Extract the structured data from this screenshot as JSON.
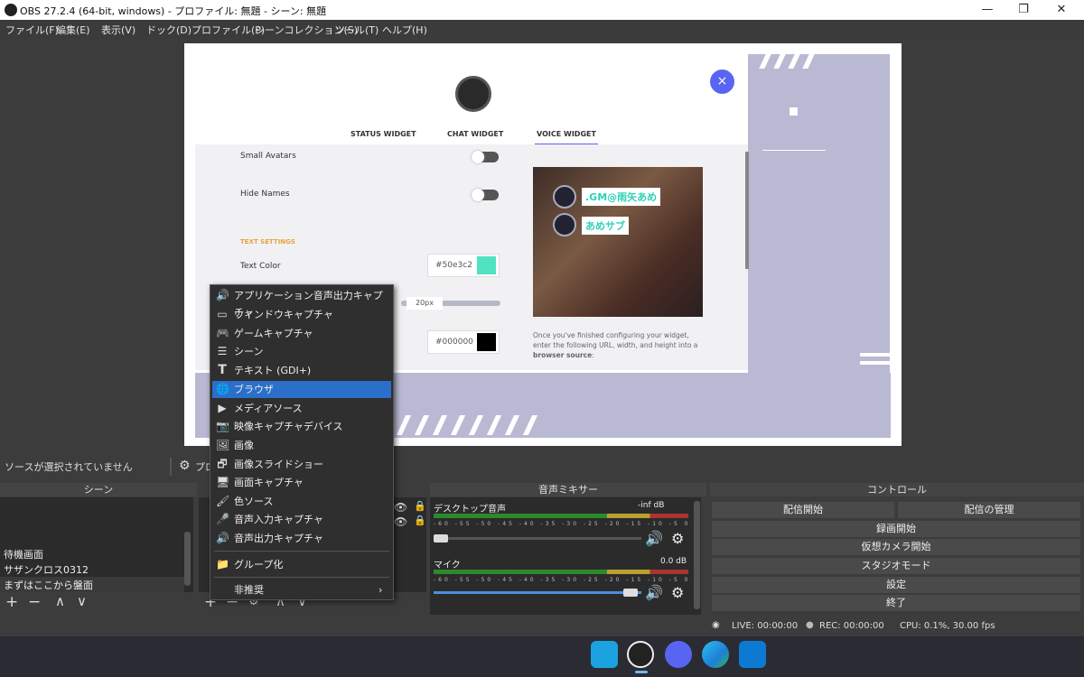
{
  "window": {
    "title": "OBS 27.2.4 (64-bit, windows) - プロファイル: 無題 - シーン: 無題",
    "minimize": "—",
    "maximize": "❐",
    "close": "✕"
  },
  "menubar": [
    "ファイル(F)",
    "編集(E)",
    "表示(V)",
    "ドック(D)",
    "プロファイル(P)",
    "シーンコレクション(S)",
    "ツール(T)",
    "ヘルプ(H)"
  ],
  "preview": {
    "tabs": [
      "STATUS WIDGET",
      "CHAT WIDGET",
      "VOICE WIDGET"
    ],
    "settings": {
      "small_avatars": "Small Avatars",
      "hide_names": "Hide Names",
      "text_settings": "TEXT SETTINGS",
      "text_color": "Text Color",
      "text_color_value": "#50e3c2",
      "size_value": "20px",
      "bg_color_value": "#000000"
    },
    "voice_names": [
      ".GM@雨矢あめ",
      "あめサブ"
    ],
    "help_text": "Once you've finished configuring your widget, enter the following URL, width, and height into a",
    "help_bold": "browser source",
    "help_colon": ":",
    "close_symbol": "×",
    "colors": {
      "accent": "#5865f2",
      "teal": "#50e3c2"
    }
  },
  "sourcebar": {
    "no_source": "ソースが選択されていません",
    "properties": "プロ"
  },
  "scenes": {
    "header": "シーン",
    "items": [
      "待機画面",
      "サザンクロス0312",
      "まずはここから盤面"
    ],
    "buttons": [
      "+",
      "−",
      "∧",
      "∨"
    ]
  },
  "sources": {
    "buttons": [
      "+",
      "−",
      "⚙",
      "∧",
      "∨"
    ]
  },
  "context_menu": {
    "items": [
      {
        "icon": "🔊",
        "label": "アプリケーション音声出力キャプチャ"
      },
      {
        "icon": "▭",
        "label": "ウィンドウキャプチャ"
      },
      {
        "icon": "🎮",
        "label": "ゲームキャプチャ"
      },
      {
        "icon": "☰",
        "label": "シーン"
      },
      {
        "icon": "T",
        "label": "テキスト (GDI+)"
      },
      {
        "icon": "🌐",
        "label": "ブラウザ"
      },
      {
        "icon": "▶",
        "label": "メディアソース"
      },
      {
        "icon": "📷",
        "label": "映像キャプチャデバイス"
      },
      {
        "icon": "🖼",
        "label": "画像"
      },
      {
        "icon": "🗗",
        "label": "画像スライドショー"
      },
      {
        "icon": "🖥",
        "label": "画面キャプチャ"
      },
      {
        "icon": "🖌",
        "label": "色ソース"
      },
      {
        "icon": "🎤",
        "label": "音声入力キャプチャ"
      },
      {
        "icon": "🔊",
        "label": "音声出力キャプチャ"
      }
    ],
    "group": {
      "icon": "📁",
      "label": "グループ化"
    },
    "deprecated": {
      "label": "非推奨",
      "arrow": "›"
    }
  },
  "mixer": {
    "header": "音声ミキサー",
    "channels": [
      {
        "name": "デスクトップ音声",
        "level": "-inf dB",
        "volume": 0.0
      },
      {
        "name": "マイク",
        "level": "0.0 dB",
        "volume": 1.0
      }
    ],
    "scale": "-60 -55 -50 -45 -40 -35 -30 -25 -20 -15 -10 -5 0"
  },
  "controls": {
    "header": "コントロール",
    "start_stream": "配信開始",
    "manage_stream": "配信の管理",
    "start_record": "録画開始",
    "virtual_cam": "仮想カメラ開始",
    "studio_mode": "スタジオモード",
    "settings": "設定",
    "exit": "終了"
  },
  "status": {
    "live": "LIVE: 00:00:00",
    "rec": "REC: 00:00:00",
    "cpu": "CPU: 0.1%, 30.00 fps"
  }
}
